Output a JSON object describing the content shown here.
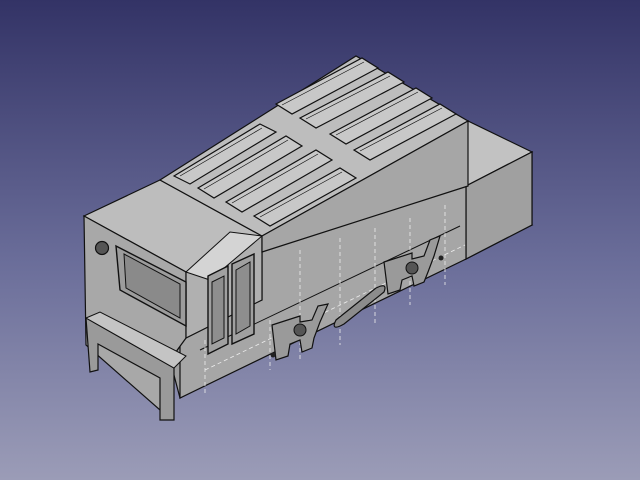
{
  "viewport": {
    "background_top": "#333366",
    "background_bottom": "#9b9cb7",
    "view_mode": "isometric"
  },
  "model": {
    "kind": "locomotive-body-shell",
    "face_colors": {
      "top": "#bdbdbd",
      "front": "#a8a8a8",
      "side": "#9e9e9e",
      "edge": "#111111",
      "hidden_edge": "#eeeeee"
    },
    "roof_panel_count": 8,
    "side_slot_count": 2,
    "visible_holes": 4
  }
}
